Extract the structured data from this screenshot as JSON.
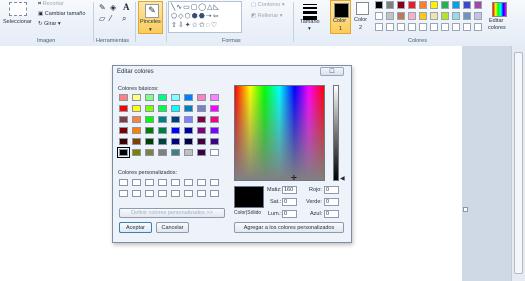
{
  "ribbon": {
    "image_group": {
      "select_label": "Seleccionar",
      "crop_label": "Recortar",
      "resize_label": "Cambiar tamaño",
      "rotate_label": "Girar",
      "group_label": "Imagen"
    },
    "tools_group": {
      "group_label": "Herramientas"
    },
    "brushes_label": "Pinceles",
    "shapes_group": {
      "outline_label": "Contorno",
      "fill_label": "Rellenar",
      "group_label": "Formas"
    },
    "size_label": "Tamaño",
    "color1_label": "Color",
    "color1_num": "1",
    "color2_label": "Color",
    "color2_num": "2",
    "colors_group_label": "Colores",
    "edit_colors_line1": "Editar",
    "edit_colors_line2": "colores",
    "palette_row1": [
      "#000000",
      "#7f7f7f",
      "#880015",
      "#ed1c24",
      "#ff7f27",
      "#fff200",
      "#22b14c",
      "#00a2e8",
      "#3f48cc",
      "#a349a4"
    ],
    "palette_row2": [
      "#ffffff",
      "#c3c3c3",
      "#b97a57",
      "#ffaec9",
      "#ffc90e",
      "#efe4b0",
      "#b5e61d",
      "#99d9ea",
      "#7092be",
      "#c8bfe7"
    ]
  },
  "dialog": {
    "title": "Editar colores",
    "close_symbol": "☐",
    "basic_colors_label": "Colores básicos:",
    "basic_colors": [
      [
        "#ff8080",
        "#ffff80",
        "#80ff80",
        "#00ff80",
        "#80ffff",
        "#0080ff",
        "#ff80c0",
        "#ff80ff"
      ],
      [
        "#ff0000",
        "#ffff00",
        "#80ff00",
        "#00ff40",
        "#00ffff",
        "#0080c0",
        "#8080c0",
        "#ff00ff"
      ],
      [
        "#804040",
        "#ff8040",
        "#00ff00",
        "#008080",
        "#004080",
        "#8080ff",
        "#800040",
        "#ff0080"
      ],
      [
        "#800000",
        "#ff8000",
        "#008000",
        "#008040",
        "#0000ff",
        "#0000a0",
        "#800080",
        "#8000ff"
      ],
      [
        "#400000",
        "#804000",
        "#004000",
        "#004040",
        "#000080",
        "#000040",
        "#400040",
        "#400080"
      ],
      [
        "#000000",
        "#808000",
        "#808040",
        "#808080",
        "#408080",
        "#c0c0c0",
        "#400040",
        "#ffffff"
      ]
    ],
    "custom_colors_label": "Colores personalizados:",
    "define_button": "Definir colores personalizados >>",
    "ok_button": "Aceptar",
    "cancel_button": "Cancelar",
    "add_button": "Agregar a los colores personalizados",
    "color_solid_label": "Color|Sólido",
    "hue_label": "Matiz:",
    "hue_value": "160",
    "sat_label": "Sat.:",
    "sat_value": "0",
    "lum_label": "Lum.:",
    "lum_value": "0",
    "red_label": "Rojo:",
    "red_value": "0",
    "green_label": "Verde:",
    "green_value": "0",
    "blue_label": "Azul:",
    "blue_value": "0",
    "selected_color": "#000000"
  }
}
